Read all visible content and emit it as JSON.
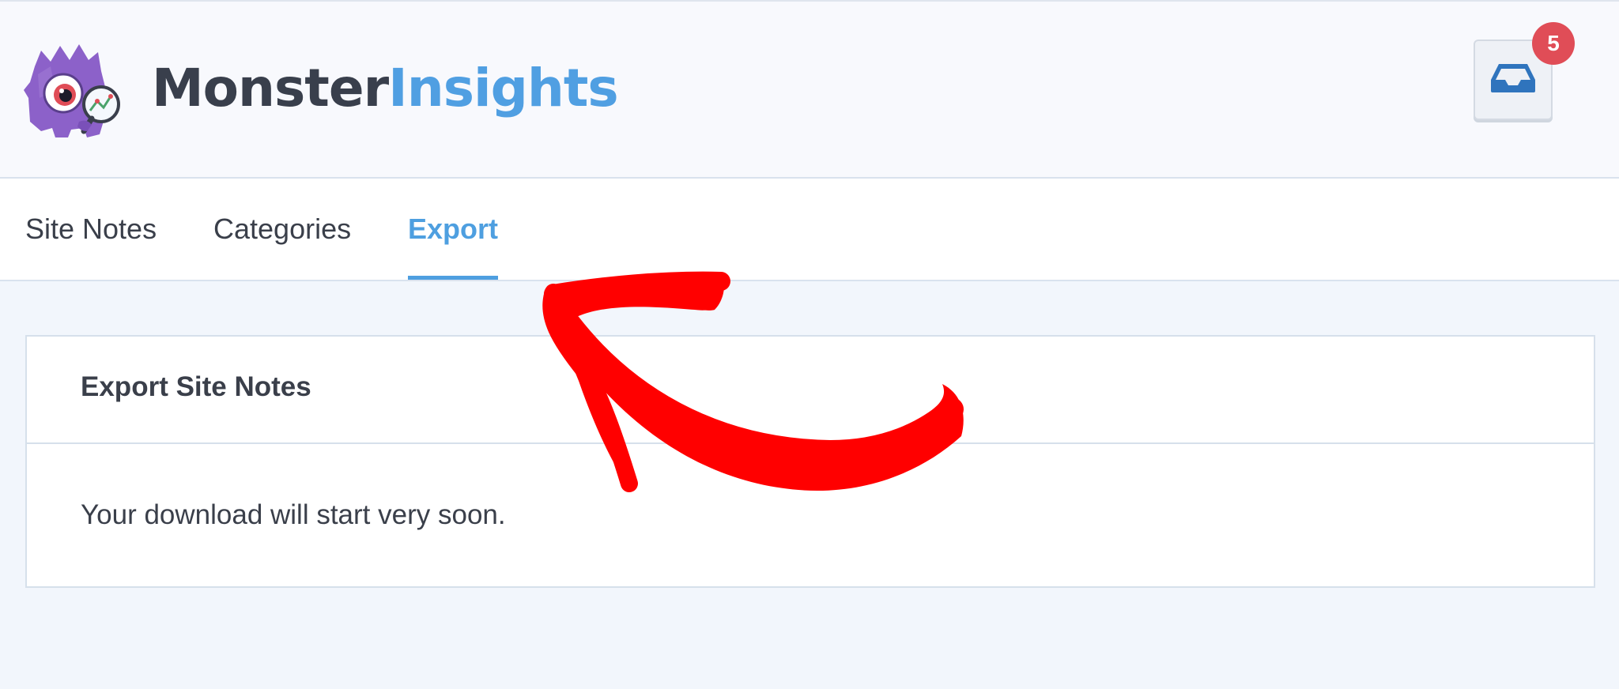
{
  "header": {
    "brand_part1": "Monster",
    "brand_part2": "Insights",
    "logo_icon": "monster-logo-icon",
    "inbox_icon": "inbox-tray-icon",
    "notification_count": "5"
  },
  "tabs": [
    {
      "label": "Site Notes",
      "active": false
    },
    {
      "label": "Categories",
      "active": false
    },
    {
      "label": "Export",
      "active": true
    }
  ],
  "panel": {
    "title": "Export Site Notes",
    "message": "Your download will start very soon."
  },
  "colors": {
    "accent": "#509fe2",
    "badge": "#e04d57",
    "annotation": "#ff0000",
    "logo_purple": "#8c61c9"
  }
}
